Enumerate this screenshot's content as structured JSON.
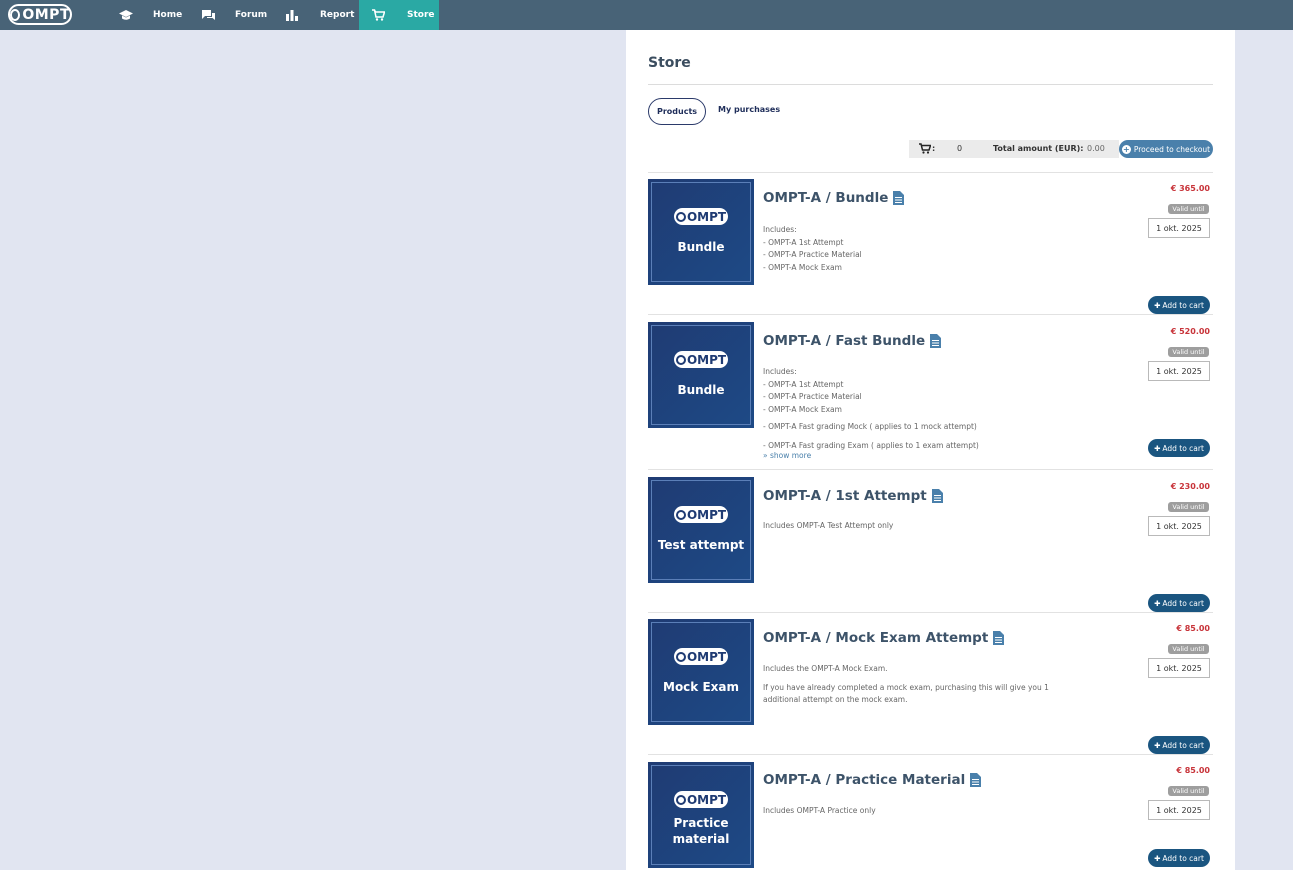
{
  "nav": {
    "logo": "OMPT",
    "items": [
      {
        "label": "Home",
        "icon": "graduation-cap-icon"
      },
      {
        "label": "Forum",
        "icon": "chat-bubbles-icon"
      },
      {
        "label": "Report",
        "icon": "bar-chart-icon"
      },
      {
        "label": "Store",
        "icon": "shopping-cart-icon",
        "active": true
      }
    ]
  },
  "page": {
    "title": "Store",
    "tabs": [
      "Products",
      "My purchases"
    ]
  },
  "cart": {
    "colon": ":",
    "count": "0",
    "total_label": "Total amount (EUR):",
    "total_value": "0.00",
    "checkout_label": "Proceed to checkout"
  },
  "products": [
    {
      "title": "OMPT-A / Bundle",
      "thumb_logo": "OMPT",
      "thumb_label": "Bundle",
      "description": [
        "Includes:",
        "- OMPT-A 1st Attempt",
        "- OMPT-A Practice Material",
        "- OMPT-A Mock Exam"
      ],
      "price": "€ 365.00",
      "valid_label": "Valid until",
      "valid_date": "1 okt. 2025",
      "add_label": "Add to cart"
    },
    {
      "title": "OMPT-A / Fast Bundle",
      "thumb_logo": "OMPT",
      "thumb_label": "Bundle",
      "description": [
        "Includes:",
        "- OMPT-A 1st Attempt",
        "- OMPT-A Practice Material",
        "- OMPT-A Mock Exam"
      ],
      "extra": [
        "- OMPT-A Fast grading Mock ( applies to 1 mock attempt)",
        "- OMPT-A Fast grading Exam ( applies to 1 exam attempt)"
      ],
      "show_more": "show more",
      "price": "€ 520.00",
      "valid_label": "Valid until",
      "valid_date": "1 okt. 2025",
      "add_label": "Add to cart"
    },
    {
      "title": "OMPT-A / 1st Attempt",
      "thumb_logo": "OMPT",
      "thumb_label": "Test attempt",
      "description": [
        "Includes OMPT-A Test Attempt only"
      ],
      "price": "€ 230.00",
      "valid_label": "Valid until",
      "valid_date": "1 okt. 2025",
      "add_label": "Add to cart"
    },
    {
      "title": "OMPT-A / Mock Exam Attempt",
      "thumb_logo": "OMPT",
      "thumb_label": "Mock Exam",
      "description": [
        "Includes the OMPT-A Mock Exam."
      ],
      "extra": [
        "If you have already completed a mock exam, purchasing this will give you 1",
        "additional attempt on the mock exam."
      ],
      "price": "€ 85.00",
      "valid_label": "Valid until",
      "valid_date": "1 okt. 2025",
      "add_label": "Add to cart"
    },
    {
      "title": "OMPT-A / Practice Material",
      "thumb_logo": "OMPT",
      "thumb_label_1": "Practice",
      "thumb_label_2": "material",
      "description": [
        "Includes OMPT-A Practice only"
      ],
      "price": "€ 85.00",
      "valid_label": "Valid until",
      "valid_date": "1 okt. 2025",
      "add_label": "Add to cart"
    }
  ]
}
